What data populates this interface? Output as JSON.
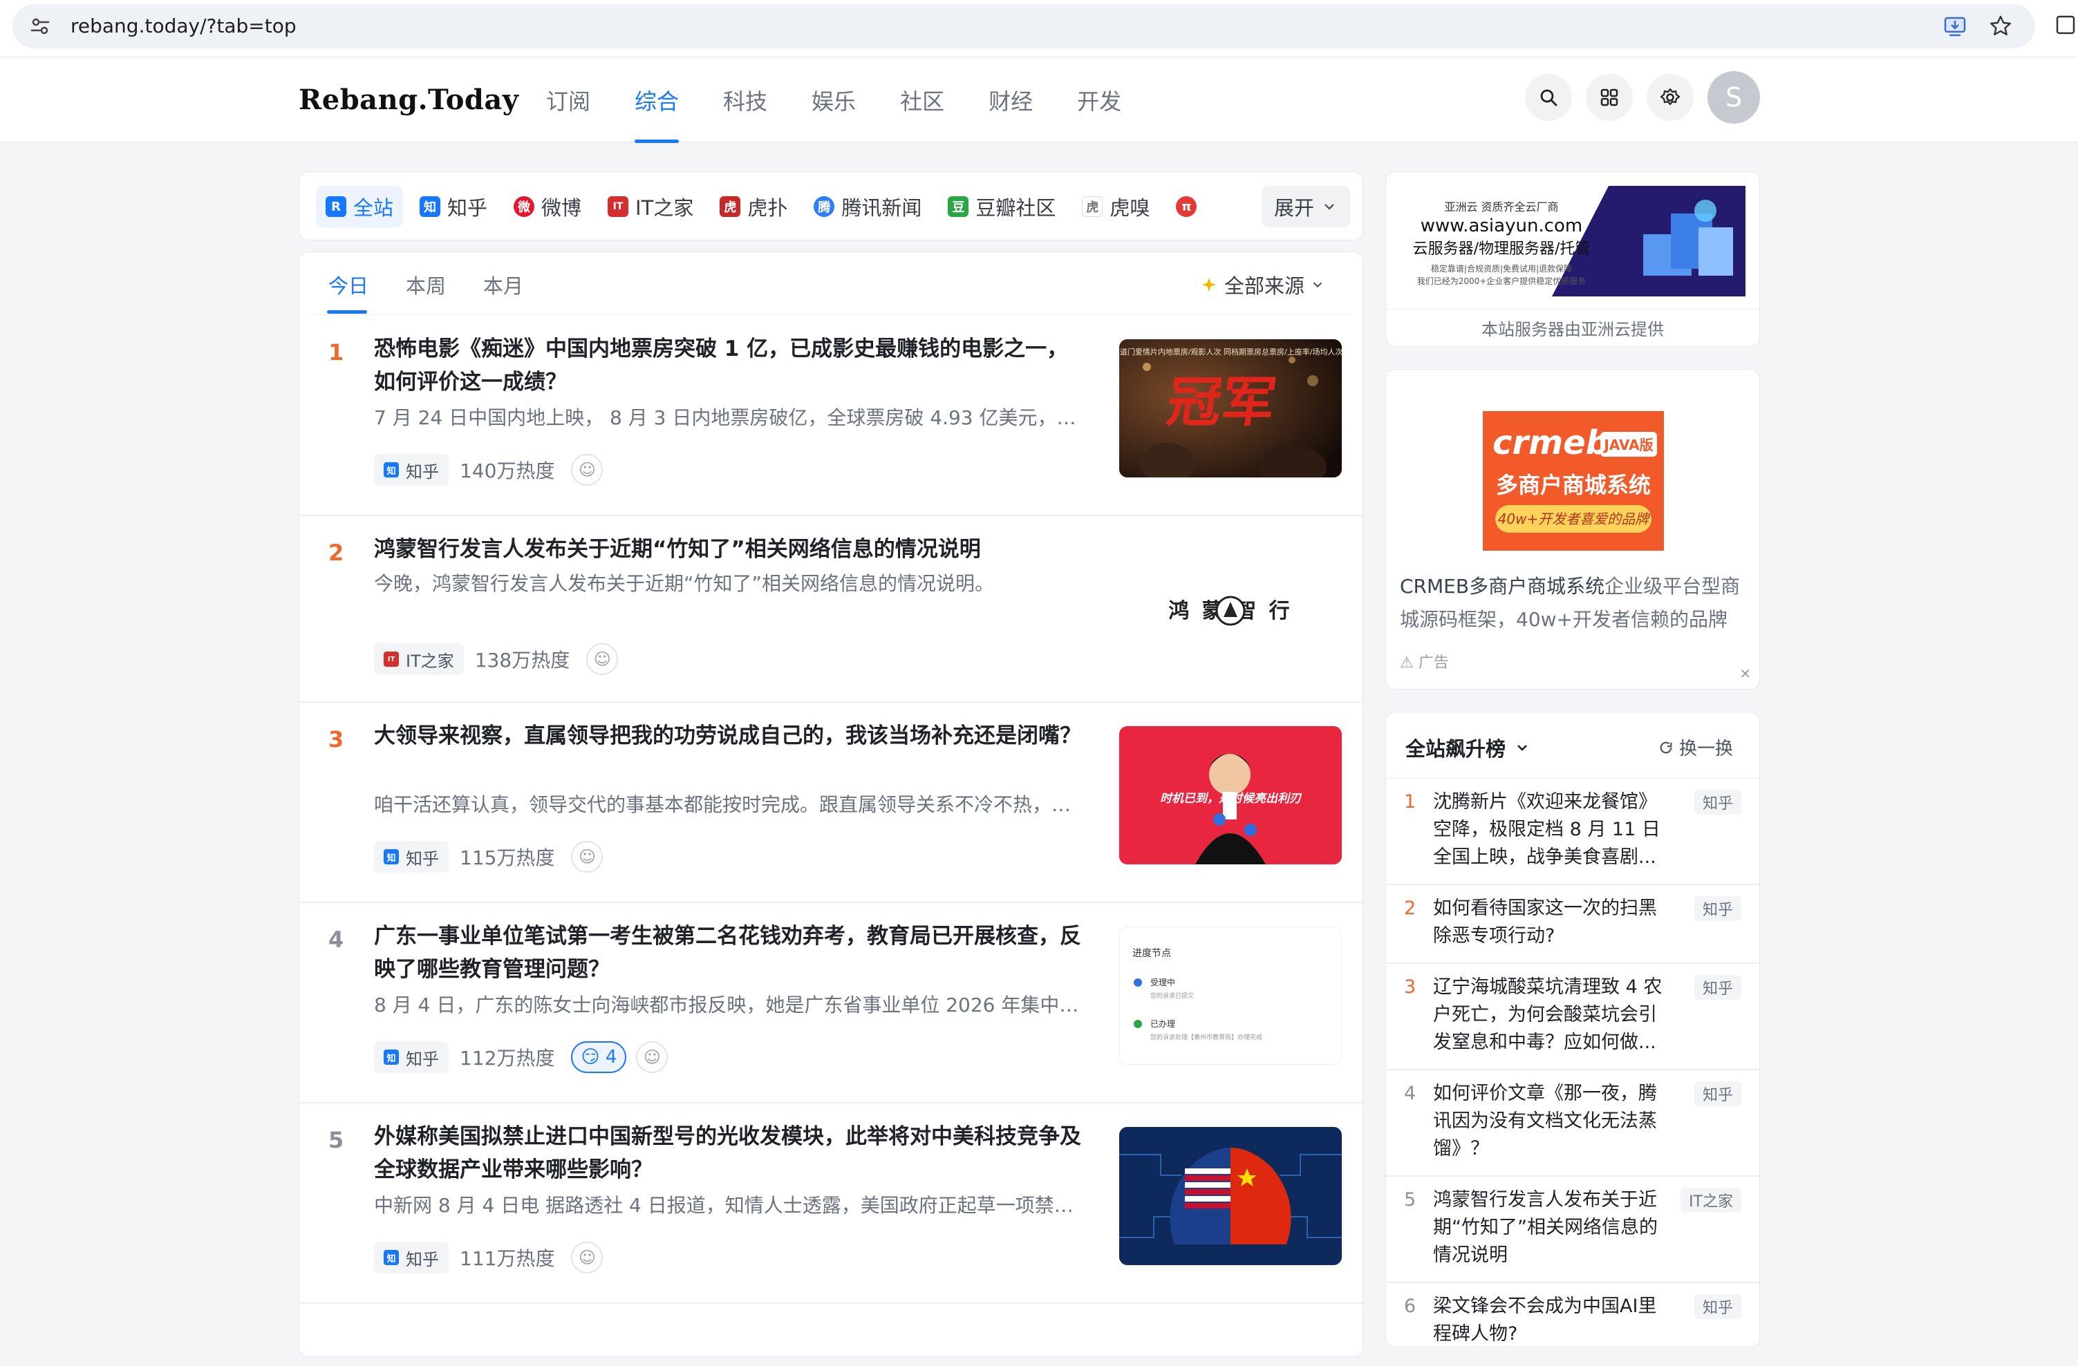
{
  "browser": {
    "url": "rebang.today/?tab=top"
  },
  "header": {
    "logo": "Rebang.Today",
    "nav": [
      "订阅",
      "综合",
      "科技",
      "娱乐",
      "社区",
      "财经",
      "开发"
    ],
    "active_nav": "综合",
    "avatar_letter": "S"
  },
  "sources": {
    "items": [
      {
        "label": "全站",
        "icon_text": "R",
        "icon_color": "#1677ff"
      },
      {
        "label": "知乎",
        "icon_text": "知",
        "icon_color": "#1677ff"
      },
      {
        "label": "微博",
        "icon_text": "微",
        "icon_color": "#e6162d"
      },
      {
        "label": "IT之家",
        "icon_text": "IT",
        "icon_color": "#d32f2f"
      },
      {
        "label": "虎扑",
        "icon_text": "虎",
        "icon_color": "#c62828"
      },
      {
        "label": "腾讯新闻",
        "icon_text": "腾",
        "icon_color": "#2e7df6"
      },
      {
        "label": "豆瓣社区",
        "icon_text": "豆",
        "icon_color": "#2aa745"
      },
      {
        "label": "虎嗅",
        "icon_text": "虎",
        "icon_color": "#ffffff"
      },
      {
        "label": "",
        "icon_text": "π",
        "icon_color": "#e53935"
      }
    ],
    "expand_label": "展开"
  },
  "period": {
    "tabs": [
      "今日",
      "本周",
      "本月"
    ],
    "active": "今日",
    "filter_label": "全部来源"
  },
  "items": [
    {
      "rank": "1",
      "title": "恐怖电影《痴迷》中国内地票房突破 1 亿，已成影史最赚钱的电影之一，如何评价这一成绩？",
      "desc": "7 月 24 日中国内地上映， 8 月 3 日内地票房破亿，全球票房破 4.93 亿美元，制...",
      "source": "知乎",
      "heat": "140万热度",
      "thumb_text": "冠军",
      "thumb_sub": "2026年道门爱情片内地票房/观影人次 同档期票房总票房/上座率/场均人次/总人次"
    },
    {
      "rank": "2",
      "title": "鸿蒙智行发言人发布关于近期“竹知了”相关网络信息的情况说明",
      "desc": "今晚，鸿蒙智行发言人发布关于近期“竹知了”相关网络信息的情况说明。",
      "source": "IT之家",
      "heat": "138万热度",
      "thumb_text": "鸿 蒙  智 行"
    },
    {
      "rank": "3",
      "title": "大领导来视察，直属领导把我的功劳说成自己的，我该当场补充还是闭嘴？",
      "desc": "咱干活还算认真，领导交代的事基本都能按时完成。跟直属领导关系不冷不热，没...",
      "source": "知乎",
      "heat": "115万热度",
      "thumb_text": "时机已到，是时候亮出利刃"
    },
    {
      "rank": "4",
      "title": "广东一事业单位笔试第一考生被第二名花钱劝弃考，教育局已开展核查，反映了哪些教育管理问题？",
      "desc": "8 月 4 日，广东的陈女士向海峡都市报反映，她是广东省事业单位 2026 年集中公...",
      "source": "知乎",
      "heat": "112万热度",
      "reaction": "😏 4",
      "thumb_lines": [
        "进度节点",
        "受理中",
        "您的诉求已提交",
        "已办理",
        "您的诉求处理【惠州市教育局】办理完成"
      ]
    },
    {
      "rank": "5",
      "title": "外媒称美国拟禁止进口中国新型号的光收发模块，此举将对中美科技竞争及全球数据产业带来哪些影响？",
      "desc": "中新网 8 月 4 日电 据路透社 4 日报道，知情人士透露，美国政府正起草一项禁令...",
      "source": "知乎",
      "heat": "111万热度"
    }
  ],
  "ads": {
    "asiayun": {
      "line1": "亚洲云 资质齐全云厂商",
      "line2": "www.asiayun.com",
      "line3": "云服务器/物理服务器/托管",
      "line4": "稳定靠谱|合规资质|免费试用|退款保障",
      "line5": "我们已经为2000+企业客户提供稳定优质服务",
      "caption": "本站服务器由亚洲云提供"
    },
    "crmeb": {
      "brand": "crmeb",
      "tag": "JAVA版",
      "headline": "多商户商城系统",
      "slogan": "40w+开发者喜爱的品牌",
      "text_strong": "CRMEB多商户商城系统",
      "text_rest": "企业级平台型商城源码框架，40w+开发者信赖的品牌",
      "label": "广告",
      "close": "✕"
    }
  },
  "ranking": {
    "title": "全站飙升榜",
    "swap_label": "换一换",
    "items": [
      {
        "rank": "1",
        "text": "沈腾新片《欢迎来龙餐馆》空降，极限定档 8 月 11 日全国上映，战争美食喜剧...",
        "source": "知乎"
      },
      {
        "rank": "2",
        "text": "如何看待国家这一次的扫黑除恶专项行动?",
        "source": "知乎"
      },
      {
        "rank": "3",
        "text": "辽宁海城酸菜坑清理致 4 农户死亡，为何会酸菜坑会引发窒息和中毒？应如何做...",
        "source": "知乎"
      },
      {
        "rank": "4",
        "text": "如何评价文章《那一夜，腾讯因为没有文档文化无法蒸馏》？",
        "source": "知乎"
      },
      {
        "rank": "5",
        "text": "鸿蒙智行发言人发布关于近期“竹知了”相关网络信息的情况说明",
        "source": "IT之家"
      },
      {
        "rank": "6",
        "text": "梁文锋会不会成为中国AI里程碑人物?",
        "source": "知乎"
      }
    ]
  },
  "colors": {
    "accent": "#1677ff",
    "rank_hot": "#f0692a",
    "rank_normal": "#8a9099"
  }
}
